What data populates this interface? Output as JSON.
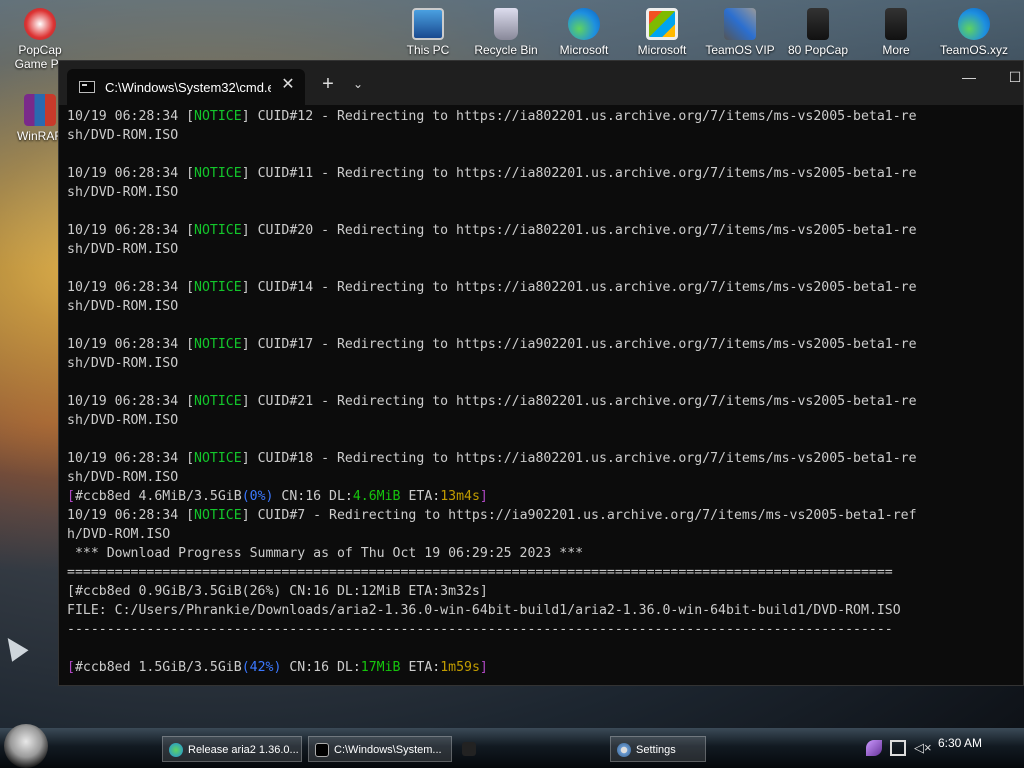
{
  "desktop": {
    "icons": [
      {
        "label": "PopCap\nGame Pa",
        "name": "popcap-game-pack-icon"
      },
      {
        "label": "WinRAR",
        "name": "winrar-icon"
      },
      {
        "label": "This PC",
        "name": "this-pc-icon"
      },
      {
        "label": "Recycle Bin",
        "name": "recycle-bin-icon"
      },
      {
        "label": "Microsoft",
        "name": "microsoft-edge-icon"
      },
      {
        "label": "Microsoft",
        "name": "microsoft-store-icon"
      },
      {
        "label": "TeamOS VIP",
        "name": "teamos-vip-icon"
      },
      {
        "label": "80 PopCap",
        "name": "80-popcap-icon"
      },
      {
        "label": "More",
        "name": "more-icon"
      },
      {
        "label": "TeamOS.xyz",
        "name": "teamos-xyz-icon"
      }
    ]
  },
  "terminal": {
    "tab_title": "C:\\Windows\\System32\\cmd.e",
    "tab_close": "✕",
    "new_tab": "+",
    "dropdown": "⌄",
    "minimize": "—",
    "maximize": "☐",
    "lines": [
      {
        "segs": [
          {
            "t": "10/19 06:28:34 ["
          },
          {
            "t": "NOTICE",
            "c": "notice"
          },
          {
            "t": "] CUID#12 - Redirecting to https://ia802201.us.archive.org/7/items/ms-vs2005-beta1-re"
          }
        ]
      },
      {
        "segs": [
          {
            "t": "sh/DVD-ROM.ISO"
          }
        ]
      },
      {
        "segs": [
          {
            "t": ""
          }
        ]
      },
      {
        "segs": [
          {
            "t": "10/19 06:28:34 ["
          },
          {
            "t": "NOTICE",
            "c": "notice"
          },
          {
            "t": "] CUID#11 - Redirecting to https://ia802201.us.archive.org/7/items/ms-vs2005-beta1-re"
          }
        ]
      },
      {
        "segs": [
          {
            "t": "sh/DVD-ROM.ISO"
          }
        ]
      },
      {
        "segs": [
          {
            "t": ""
          }
        ]
      },
      {
        "segs": [
          {
            "t": "10/19 06:28:34 ["
          },
          {
            "t": "NOTICE",
            "c": "notice"
          },
          {
            "t": "] CUID#20 - Redirecting to https://ia802201.us.archive.org/7/items/ms-vs2005-beta1-re"
          }
        ]
      },
      {
        "segs": [
          {
            "t": "sh/DVD-ROM.ISO"
          }
        ]
      },
      {
        "segs": [
          {
            "t": ""
          }
        ]
      },
      {
        "segs": [
          {
            "t": "10/19 06:28:34 ["
          },
          {
            "t": "NOTICE",
            "c": "notice"
          },
          {
            "t": "] CUID#14 - Redirecting to https://ia802201.us.archive.org/7/items/ms-vs2005-beta1-re"
          }
        ]
      },
      {
        "segs": [
          {
            "t": "sh/DVD-ROM.ISO"
          }
        ]
      },
      {
        "segs": [
          {
            "t": ""
          }
        ]
      },
      {
        "segs": [
          {
            "t": "10/19 06:28:34 ["
          },
          {
            "t": "NOTICE",
            "c": "notice"
          },
          {
            "t": "] CUID#17 - Redirecting to https://ia902201.us.archive.org/7/items/ms-vs2005-beta1-re"
          }
        ]
      },
      {
        "segs": [
          {
            "t": "sh/DVD-ROM.ISO"
          }
        ]
      },
      {
        "segs": [
          {
            "t": ""
          }
        ]
      },
      {
        "segs": [
          {
            "t": "10/19 06:28:34 ["
          },
          {
            "t": "NOTICE",
            "c": "notice"
          },
          {
            "t": "] CUID#21 - Redirecting to https://ia802201.us.archive.org/7/items/ms-vs2005-beta1-re"
          }
        ]
      },
      {
        "segs": [
          {
            "t": "sh/DVD-ROM.ISO"
          }
        ]
      },
      {
        "segs": [
          {
            "t": ""
          }
        ]
      },
      {
        "segs": [
          {
            "t": "10/19 06:28:34 ["
          },
          {
            "t": "NOTICE",
            "c": "notice"
          },
          {
            "t": "] CUID#18 - Redirecting to https://ia802201.us.archive.org/7/items/ms-vs2005-beta1-re"
          }
        ]
      },
      {
        "segs": [
          {
            "t": "sh/DVD-ROM.ISO"
          }
        ]
      },
      {
        "segs": [
          {
            "t": "[",
            "c": "brk"
          },
          {
            "t": "#ccb8ed 4.6MiB/3.5GiB"
          },
          {
            "t": "(0%)",
            "c": "pct"
          },
          {
            "t": " CN:16 DL:"
          },
          {
            "t": "4.6MiB",
            "c": "dl"
          },
          {
            "t": " ETA:"
          },
          {
            "t": "13m4s",
            "c": "eta"
          },
          {
            "t": "]",
            "c": "brk"
          }
        ]
      },
      {
        "segs": [
          {
            "t": "10/19 06:28:34 ["
          },
          {
            "t": "NOTICE",
            "c": "notice"
          },
          {
            "t": "] CUID#7 - Redirecting to https://ia902201.us.archive.org/7/items/ms-vs2005-beta1-ref"
          }
        ]
      },
      {
        "segs": [
          {
            "t": "h/DVD-ROM.ISO"
          }
        ]
      },
      {
        "segs": [
          {
            "t": " *** Download Progress Summary as of Thu Oct 19 06:29:25 2023 ***"
          }
        ]
      },
      {
        "segs": [
          {
            "t": "========================================================================================================"
          }
        ]
      },
      {
        "segs": [
          {
            "t": "[#ccb8ed 0.9GiB/3.5GiB(26%) CN:16 DL:12MiB ETA:3m32s]"
          }
        ]
      },
      {
        "segs": [
          {
            "t": "FILE: C:/Users/Phrankie/Downloads/aria2-1.36.0-win-64bit-build1/aria2-1.36.0-win-64bit-build1/DVD-ROM.ISO"
          }
        ]
      },
      {
        "segs": [
          {
            "t": "--------------------------------------------------------------------------------------------------------"
          }
        ]
      },
      {
        "segs": [
          {
            "t": ""
          }
        ]
      },
      {
        "segs": [
          {
            "t": "[",
            "c": "brk"
          },
          {
            "t": "#ccb8ed 1.5GiB/3.5GiB"
          },
          {
            "t": "(42%)",
            "c": "pct"
          },
          {
            "t": " CN:16 DL:"
          },
          {
            "t": "17MiB",
            "c": "dl"
          },
          {
            "t": " ETA:"
          },
          {
            "t": "1m59s",
            "c": "eta"
          },
          {
            "t": "]",
            "c": "brk"
          }
        ]
      }
    ]
  },
  "taskbar": {
    "buttons": [
      {
        "label": "Release aria2 1.36.0...",
        "name": "taskbar-edge-release-aria2"
      },
      {
        "label": "C:\\Windows\\System...",
        "name": "taskbar-cmd-window"
      },
      {
        "label": "Settings",
        "name": "taskbar-settings"
      }
    ],
    "time": "6:30 AM"
  }
}
